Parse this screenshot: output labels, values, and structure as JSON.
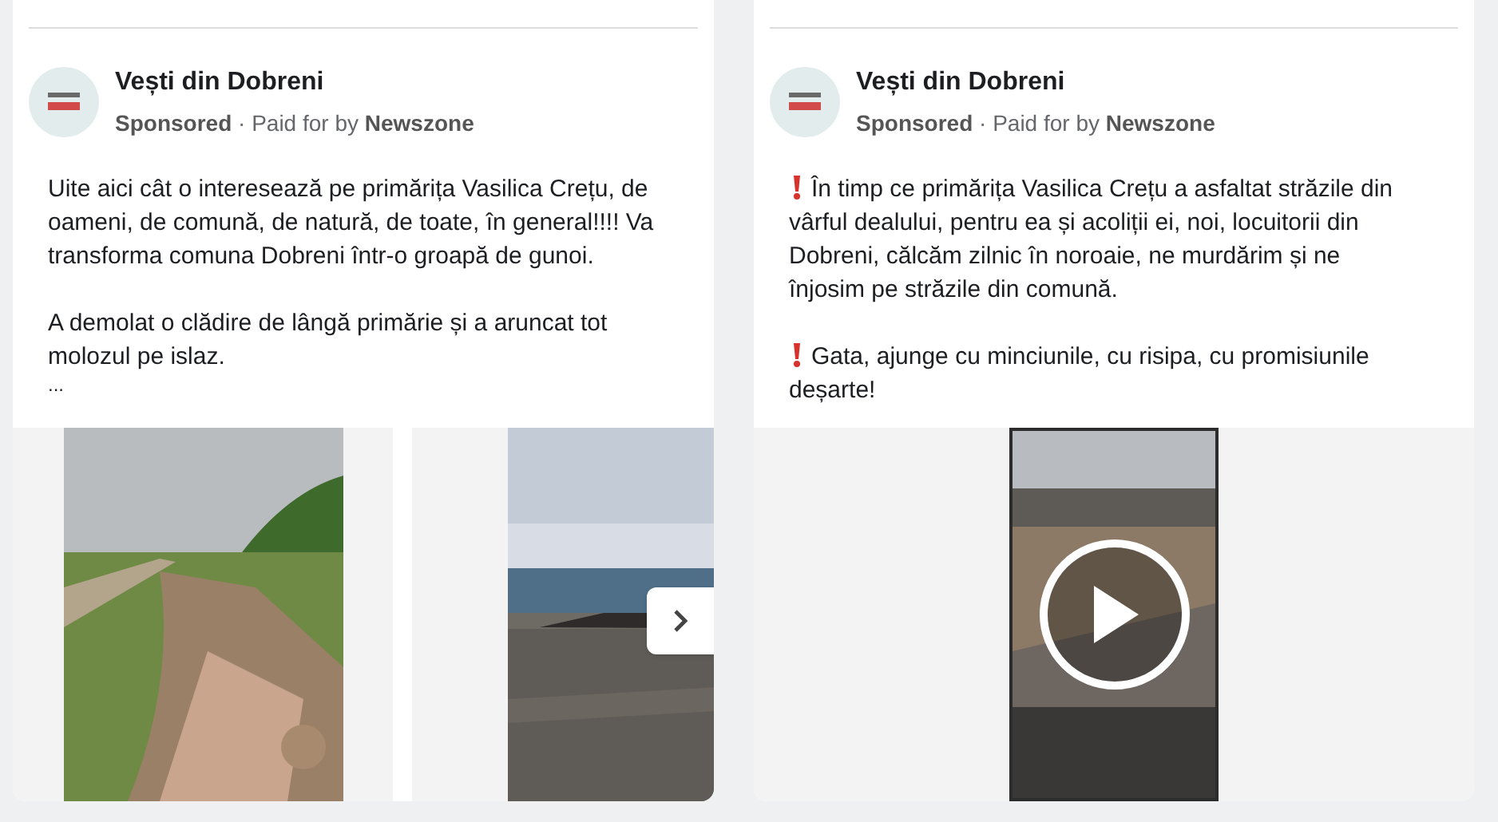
{
  "posts": [
    {
      "page_name": "Vești din Dobreni",
      "byline": "**Sponsored** · Paid for by **Newszone**",
      "paragraphs": [
        {
          "kind": "text",
          "text": "Uite aici cât o interesează pe primărița Vasilica Crețu, de oameni, de comună, de natură, de toate, în general!!!! Va transforma comuna Dobreni într-o groapă de gunoi."
        },
        {
          "kind": "text",
          "text": "A demolat o clădire de lângă primărie și a aruncat tot molozul pe islaz."
        },
        {
          "kind": "more",
          "text": "..."
        }
      ],
      "media": {
        "kind": "carousel"
      }
    },
    {
      "page_name": "Vești din Dobreni",
      "byline": "**Sponsored** · Paid for by **Newszone**",
      "paragraphs": [
        {
          "kind": "alert",
          "text": "În timp ce primărița Vasilica Crețu a asfaltat străzile din vârful dealului, pentru ea și acoliții ei, noi, locuitorii din Dobreni, călcăm zilnic în noroaie, ne murdărim și ne înjosim pe străzile din comună."
        },
        {
          "kind": "alert",
          "text": "Gata, ajunge cu minciunile, cu risipa, cu promisiunile deșarte!"
        }
      ],
      "media": {
        "kind": "video"
      }
    }
  ]
}
